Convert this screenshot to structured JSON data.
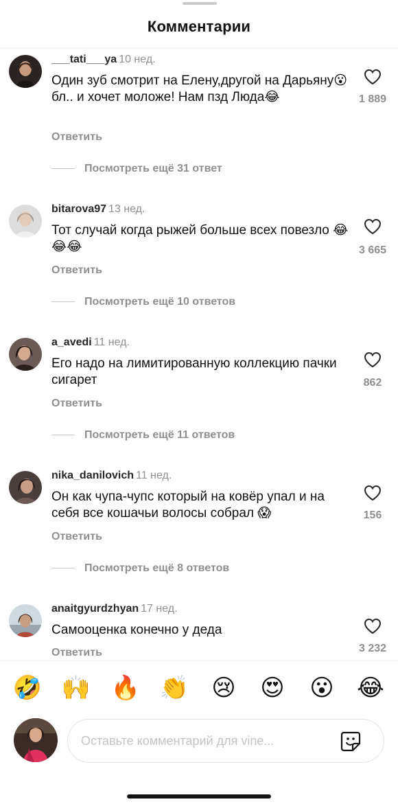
{
  "header": {
    "title": "Комментарии"
  },
  "comments": [
    {
      "username": "___tati___ya",
      "time": "10 нед.",
      "text": "Один зуб смотрит на Елену,другой на Дарьяну😮 бл.. и хочет моложе! Нам пзд Люда😂",
      "reply_label": "Ответить",
      "likes": "1 889",
      "more_replies": "Посмотреть ещё 31 ответ"
    },
    {
      "username": "bitarova97",
      "time": "13 нед.",
      "text": "Тот случай когда рыжей больше всех повезло 😂😂😂",
      "reply_label": "Ответить",
      "likes": "3 665",
      "more_replies": "Посмотреть ещё 10 ответов"
    },
    {
      "username": "a_avedi",
      "time": "11 нед.",
      "text": "Его надо на лимитированную коллекцию пачки сигарет",
      "reply_label": "Ответить",
      "likes": "862",
      "more_replies": "Посмотреть ещё 11 ответов"
    },
    {
      "username": "nika_danilovich",
      "time": "11 нед.",
      "text": "Он как чупа-чупс который на ковёр упал и на себя все кошачьи волосы собрал 😱",
      "reply_label": "Ответить",
      "likes": "156",
      "more_replies": "Посмотреть ещё 8 ответов"
    },
    {
      "username": "anaitgyurdzhyan",
      "time": "17 нед.",
      "text": "Самооценка конечно у деда",
      "reply_label": "Ответить",
      "likes": "3 232"
    }
  ],
  "emoji_bar": [
    "🤣",
    "🙌",
    "🔥",
    "👏",
    "😢",
    "😍",
    "😮",
    "😂"
  ],
  "composer": {
    "placeholder": "Оставьте комментарий для vine..."
  },
  "icons": {
    "like": "heart-outline-icon",
    "sticker": "sticker-icon"
  },
  "colors": {
    "text": "#111111",
    "secondary": "#8e8e8e",
    "divider": "#efefef",
    "placeholder": "#c3c3c3"
  }
}
